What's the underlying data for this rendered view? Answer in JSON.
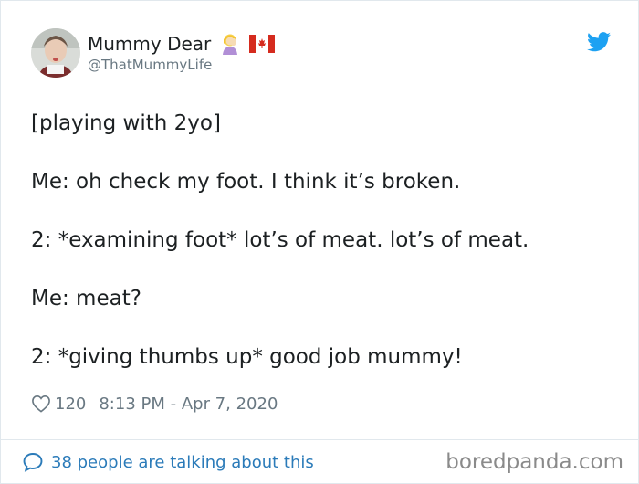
{
  "author": {
    "display_name": "Mummy Dear",
    "handle": "@ThatMummyLife",
    "emoji_icon": "woman-facepalming-icon",
    "flag_icon": "canada-flag-icon"
  },
  "tweet": {
    "lines": [
      "[playing with 2yo]",
      "",
      "Me: oh check my foot. I think it’s broken.",
      "",
      "2: *examining foot* lot’s of meat. lot’s of meat.",
      "",
      "Me: meat?",
      "",
      "2: *giving thumbs up* good job mummy!"
    ]
  },
  "meta": {
    "like_count": "120",
    "timestamp": "8:13 PM - Apr 7, 2020"
  },
  "footer": {
    "talking_text": "38 people are talking about this",
    "watermark": "boredpanda.com"
  },
  "colors": {
    "twitter_blue": "#1da1f2",
    "link_blue": "#2b7bb9",
    "muted_gray": "#697882"
  }
}
